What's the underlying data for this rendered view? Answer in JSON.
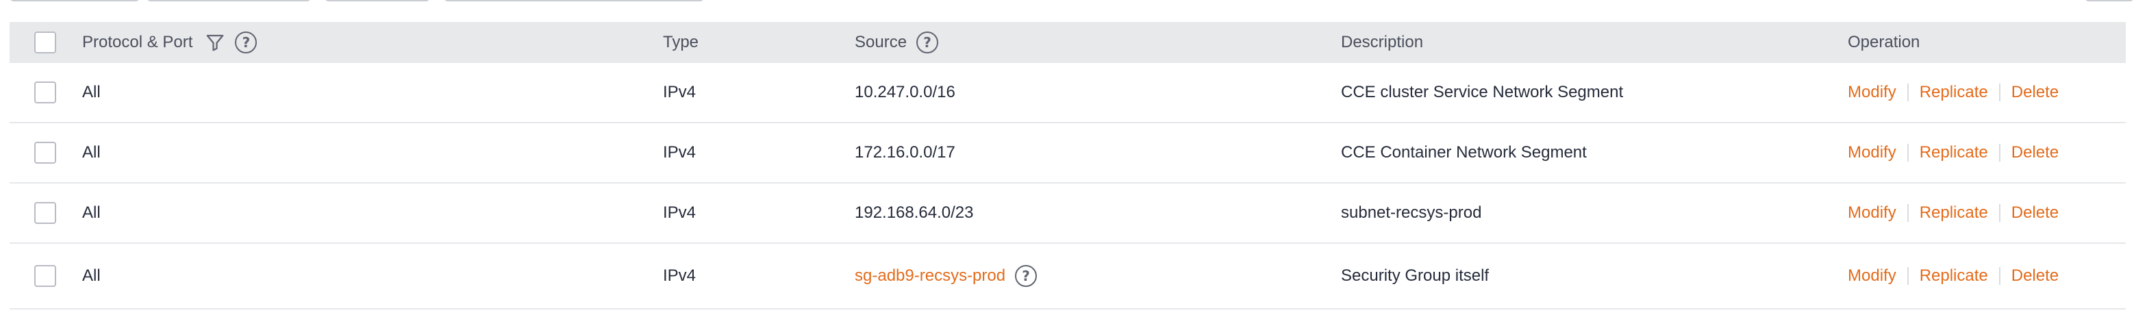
{
  "header": {
    "protocol_port": "Protocol & Port",
    "type": "Type",
    "source": "Source",
    "description": "Description",
    "operation": "Operation"
  },
  "rows": [
    {
      "protocol": "All",
      "type": "IPv4",
      "source": "10.247.0.0/16",
      "source_is_link": false,
      "description": "CCE cluster Service Network Segment"
    },
    {
      "protocol": "All",
      "type": "IPv4",
      "source": "172.16.0.0/17",
      "source_is_link": false,
      "description": "CCE Container Network Segment"
    },
    {
      "protocol": "All",
      "type": "IPv4",
      "source": "192.168.64.0/23",
      "source_is_link": false,
      "description": "subnet-recsys-prod"
    },
    {
      "protocol": "All",
      "type": "IPv4",
      "source": "sg-adb9-recsys-prod",
      "source_is_link": true,
      "description": "Security Group itself"
    }
  ],
  "operations": {
    "modify": "Modify",
    "replicate": "Replicate",
    "delete": "Delete"
  },
  "icons": {
    "help": "help-circle-icon",
    "filter": "filter-icon"
  },
  "colors": {
    "link": "#e36b1b",
    "header_bg": "#e8e9eb",
    "row_divider": "#e6e7ea"
  }
}
